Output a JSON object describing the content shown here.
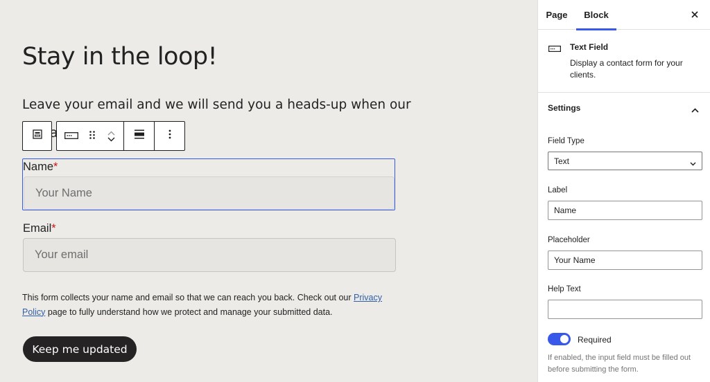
{
  "canvas": {
    "heading": "Stay in the loop!",
    "intro": "Leave your email and we will send you a heads-up when our",
    "intro_overflow": "a",
    "name_field": {
      "label": "Name",
      "required_mark": "*",
      "placeholder": "Your Name"
    },
    "email_field": {
      "label": "Email",
      "required_mark": "*",
      "placeholder": "Your email"
    },
    "notice": {
      "before_link": "This form collects your name and email so that we can reach you back. Check out our ",
      "link_text": "Privacy Policy",
      "after_link": " page to fully understand how we protect and manage your submitted data."
    },
    "cta_label": "Keep me updated"
  },
  "toolbar": {
    "buttons": [
      "form-parent-icon",
      "text-field-icon",
      "drag-handle-icon",
      "move-up-icon",
      "move-down-icon",
      "align-icon",
      "more-options-icon"
    ]
  },
  "sidebar": {
    "tabs": [
      {
        "label": "Page",
        "active": false
      },
      {
        "label": "Block",
        "active": true
      }
    ],
    "block": {
      "title": "Text Field",
      "description": "Display a contact form for your clients."
    },
    "settings": {
      "title": "Settings",
      "expanded": true,
      "field_type": {
        "label": "Field Type",
        "value": "Text"
      },
      "label": {
        "label": "Label",
        "value": "Name"
      },
      "placeholder": {
        "label": "Placeholder",
        "value": "Your Name"
      },
      "help_text": {
        "label": "Help Text",
        "value": ""
      },
      "required": {
        "label": "Required",
        "enabled": true,
        "help": "If enabled, the input field must be filled out before submitting the form."
      }
    }
  },
  "colors": {
    "canvas_bg": "#ecebe7",
    "accent": "#3858e9",
    "required": "#cc1818",
    "button_bg": "#252323"
  }
}
